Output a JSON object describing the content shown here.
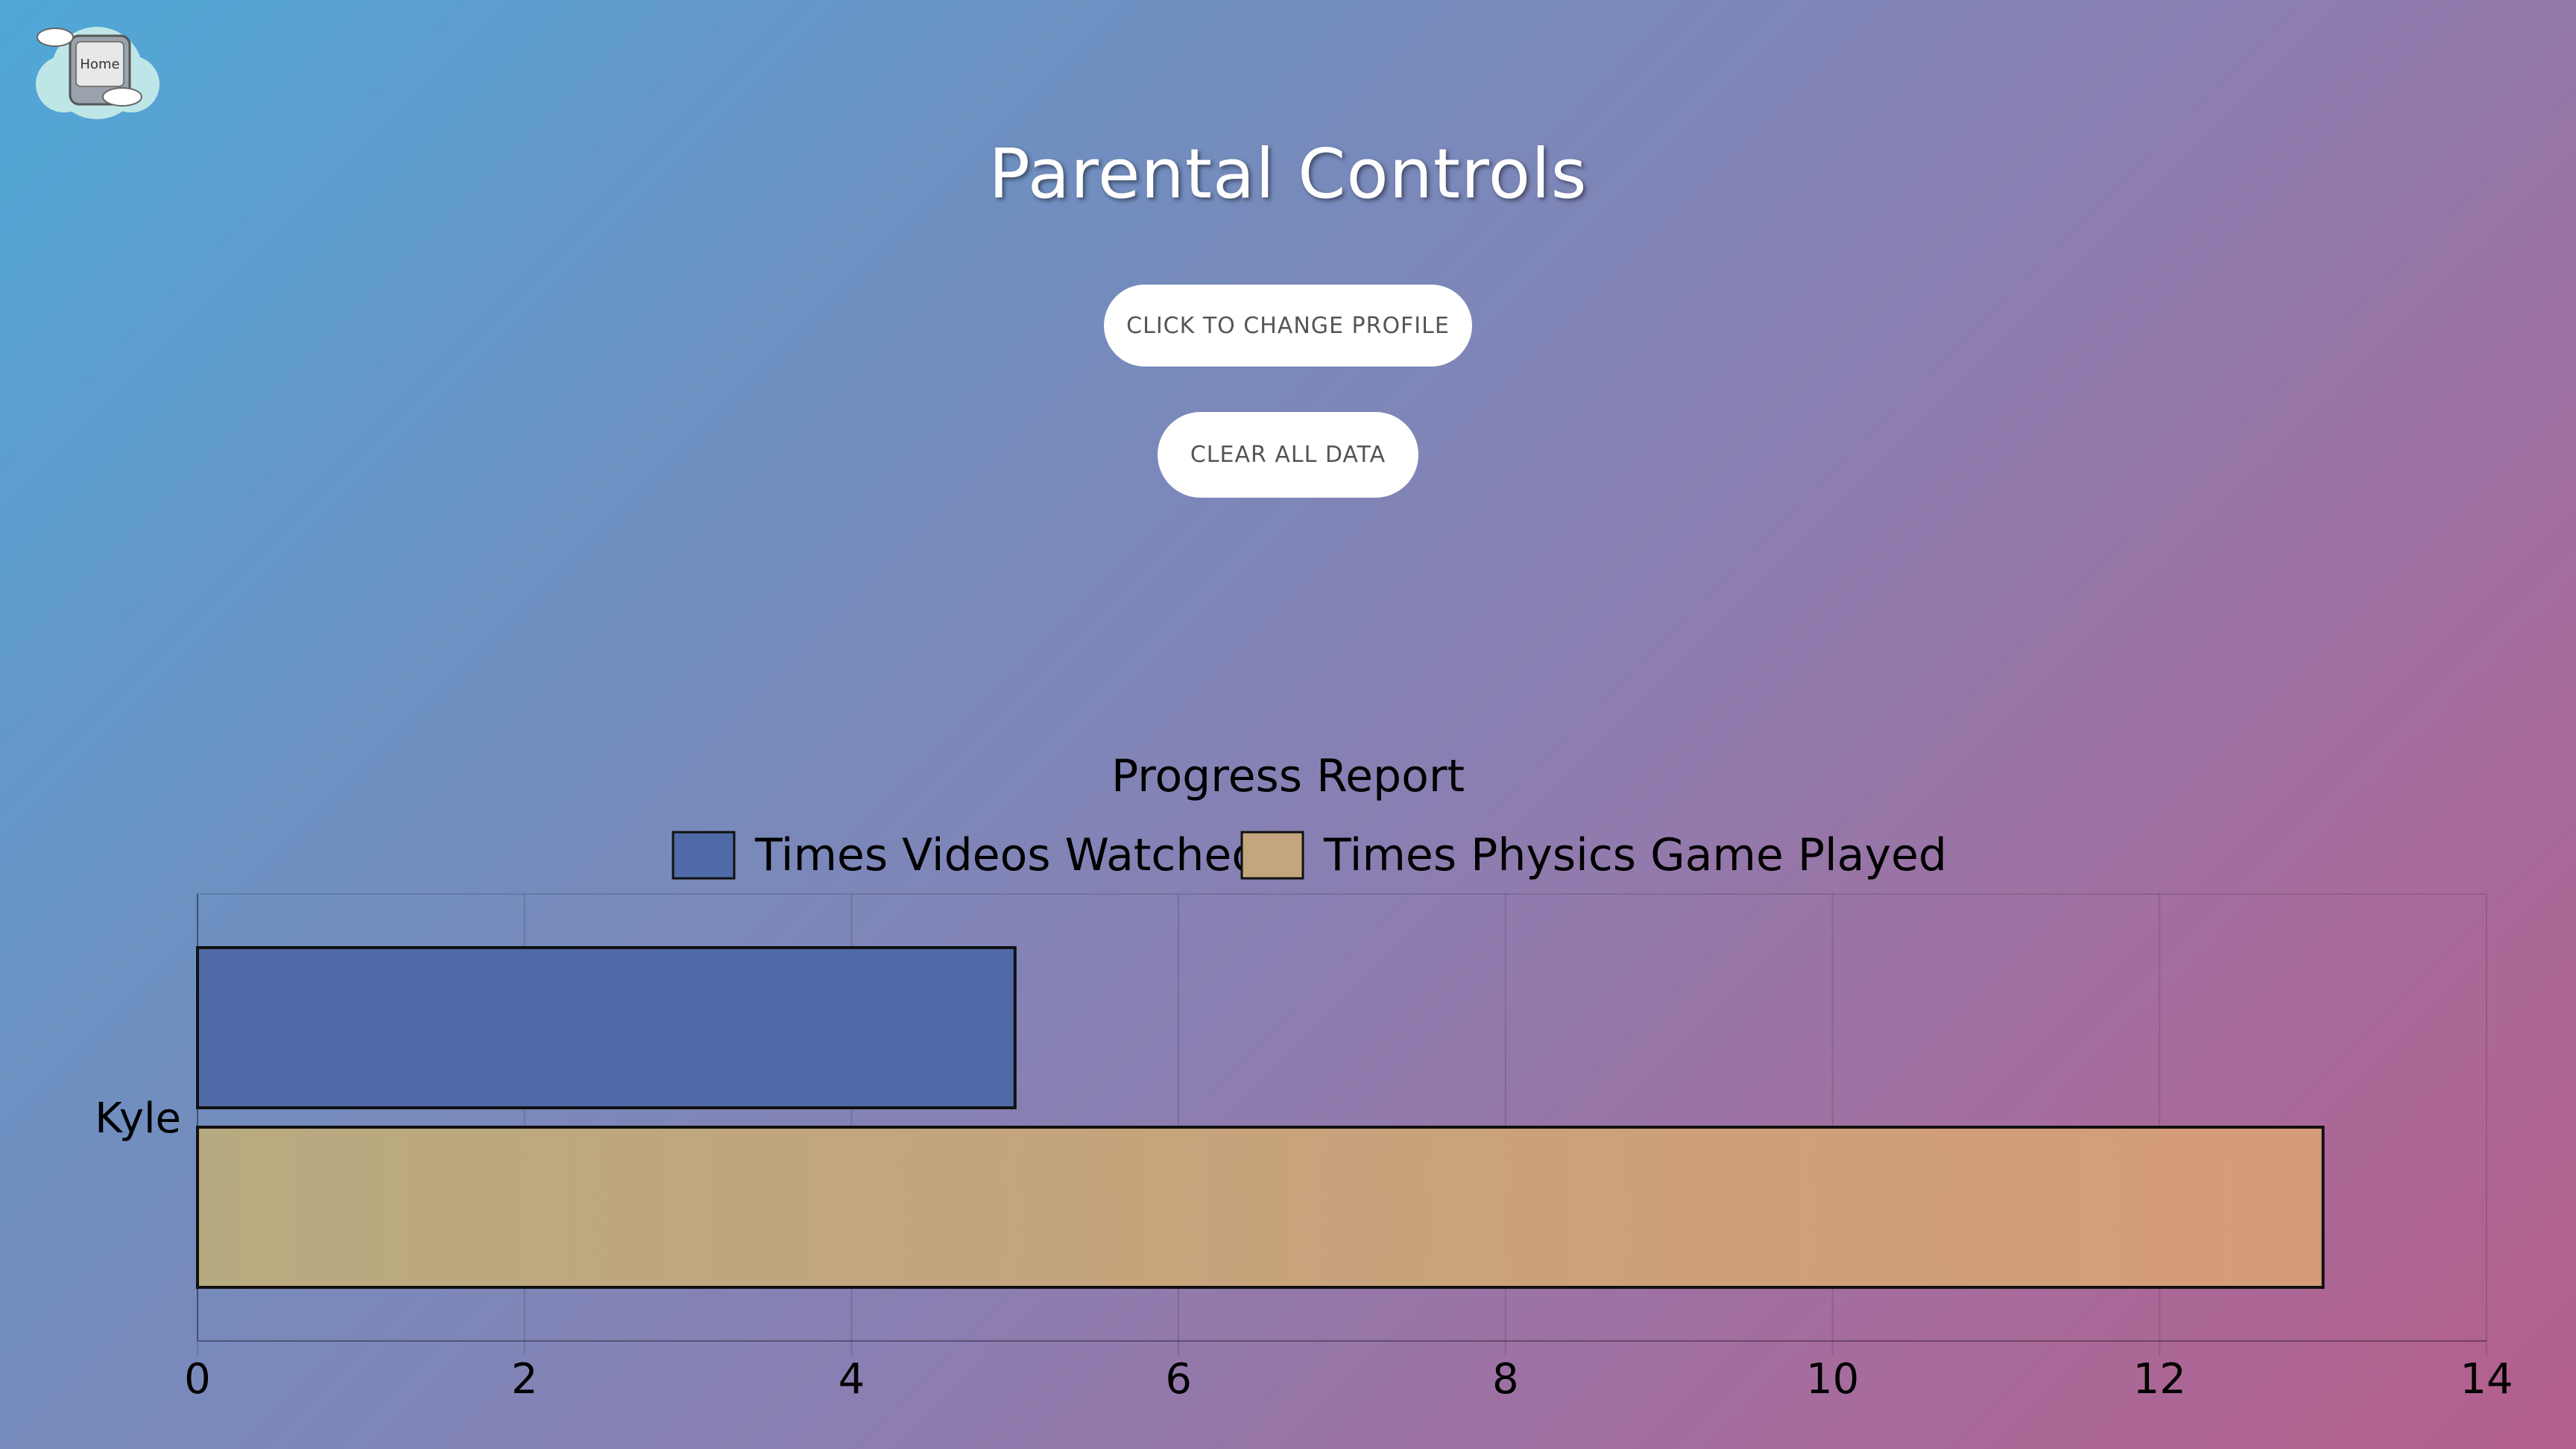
{
  "home": {
    "label": "Home"
  },
  "page_title": "Parental Controls",
  "buttons": {
    "change_profile": "CLICK TO CHANGE PROFILE",
    "clear_data": "CLEAR ALL DATA"
  },
  "chart_data": {
    "type": "bar",
    "orientation": "horizontal",
    "title": "Progress Report",
    "categories": [
      "Kyle"
    ],
    "series": [
      {
        "name": "Times Videos Watched",
        "values": [
          5
        ],
        "color": "#4f6aa6"
      },
      {
        "name": "Times Physics Game Played",
        "values": [
          13
        ],
        "color": "#c4a67e"
      }
    ],
    "xlim": [
      0,
      14
    ],
    "xticks": [
      0,
      2,
      4,
      6,
      8,
      10,
      12,
      14
    ],
    "grid": true,
    "legend": "top"
  }
}
